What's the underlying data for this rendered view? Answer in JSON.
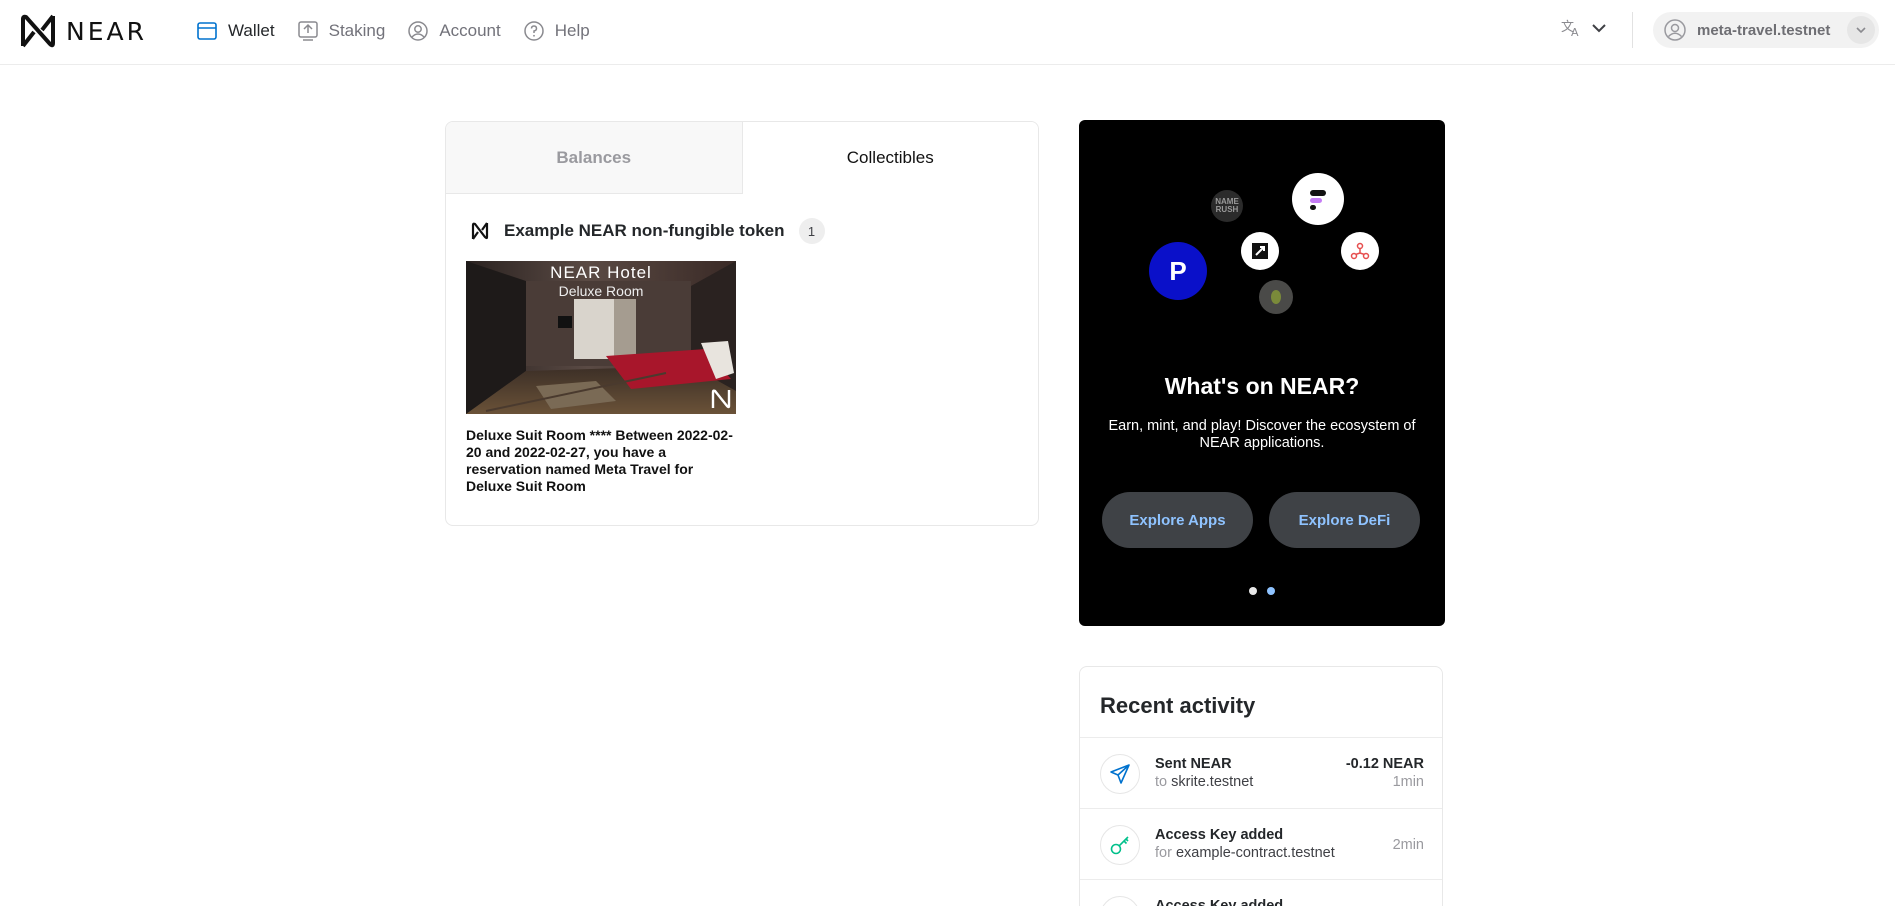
{
  "brand": {
    "name": "NEAR"
  },
  "nav": {
    "links": [
      {
        "label": "Wallet",
        "icon": "wallet-icon",
        "active": true
      },
      {
        "label": "Staking",
        "icon": "staking-icon",
        "active": false
      },
      {
        "label": "Account",
        "icon": "account-icon",
        "active": false
      },
      {
        "label": "Help",
        "icon": "help-icon",
        "active": false
      }
    ],
    "language_icon": "translate-icon",
    "account_name": "meta-travel.testnet"
  },
  "wallet": {
    "tabs": [
      {
        "label": "Balances",
        "active": false
      },
      {
        "label": "Collectibles",
        "active": true
      }
    ],
    "collection": {
      "title": "Example NEAR non-fungible token",
      "count": "1",
      "item": {
        "image_title": "NEAR Hotel",
        "image_subtitle": "Deluxe Room",
        "description": "Deluxe Suit Room **** Between 2022-02-20 and 2022-02-27, you have a reservation named Meta Travel for Deluxe Suit Room"
      }
    }
  },
  "promo": {
    "title": "What's on NEAR?",
    "text": "Earn, mint, and play! Discover the ecosystem of NEAR applications.",
    "buttons": [
      "Explore Apps",
      "Explore DeFi"
    ],
    "dots": {
      "count": 2,
      "active_index": 1
    },
    "colors": {
      "background": "#000000",
      "button_text": "#8fc3ff",
      "button_bg": "#3f4246",
      "dot_active": "#8fc3ff"
    }
  },
  "activity": {
    "title": "Recent activity",
    "items": [
      {
        "title": "Sent NEAR",
        "prefix": "to",
        "target": "skrite.testnet",
        "amount": "-0.12 NEAR",
        "time": "1min",
        "icon": "send-icon"
      },
      {
        "title": "Access Key added",
        "prefix": "for",
        "target": "example-contract.testnet",
        "amount": "",
        "time": "2min",
        "icon": "key-icon"
      },
      {
        "title": "Access Key added",
        "prefix": "",
        "target": "",
        "amount": "",
        "time": "",
        "icon": "key-icon"
      }
    ]
  },
  "colors": {
    "accent": "#0072ce",
    "key_green": "#00c08b"
  }
}
